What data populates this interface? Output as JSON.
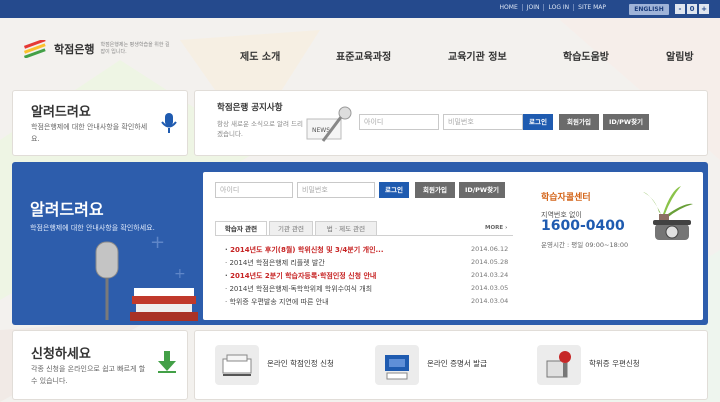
{
  "topbar": {
    "links": [
      "HOME",
      "JOIN",
      "LOG IN",
      "SITE MAP"
    ],
    "english": "ENGLISH",
    "font_controls": [
      "-",
      "0",
      "+"
    ]
  },
  "header": {
    "logo_title": "학점은행",
    "logo_sub": "학점은행제는 평생학습을 위한 길잡이 입니다.",
    "nav": [
      "제도 소개",
      "표준교육과정",
      "교육기관 정보",
      "학습도움방",
      "알림방"
    ]
  },
  "top_left_card": {
    "title": "알려드려요",
    "desc": "학점은행제에 대한 안내사항을 확인하세요."
  },
  "notice_card": {
    "title": "학점은행 공지사항",
    "desc": "항상 새로운 소식으로 알려 드리겠습니다.",
    "id_placeholder": "아이디",
    "pw_placeholder": "비밀번호",
    "login": "로그인",
    "join": "회원가입",
    "find": "ID/PW찾기"
  },
  "main": {
    "title": "알려드려요",
    "desc": "학점은행제에 대한 안내사항을 확인하세요.",
    "id_placeholder": "아이디",
    "pw_placeholder": "비밀번호",
    "login": "로그인",
    "join": "회원가입",
    "find": "ID/PW찾기",
    "tabs": [
      "학습자 관련",
      "기관 관련",
      "법 · 제도 관련"
    ],
    "more": "MORE",
    "news": [
      {
        "text": "2014년도 후기(8월) 학위신청 및 3/4분기 개인...",
        "date": "2014.06.12",
        "red": true
      },
      {
        "text": "2014년 학점은행제 리플렛 발간",
        "date": "2014.05.28",
        "red": false
      },
      {
        "text": "2014년도 2분기 학습자등록·학점인정 신청 안내",
        "date": "2014.03.24",
        "red": true
      },
      {
        "text": "2014년 학점은행제·독학학위제 학위수여식 개최",
        "date": "2014.03.05",
        "red": false
      },
      {
        "text": "학위증 우편발송 지연에 따른 안내",
        "date": "2014.03.04",
        "red": false
      }
    ],
    "call_center": {
      "title": "학습자콜센터",
      "sub": "지역번호 없이",
      "number": "1600-0400",
      "hours": "운영시간 : 평일 09:00~18:00"
    }
  },
  "apply": {
    "title": "신청하세요",
    "desc": "각종 신청을 온라인으로 쉽고 빠르게 할 수 있습니다.",
    "services": [
      "온라인 학점인정 신청",
      "온라인 증명서 발급",
      "학위증 우편신청"
    ]
  },
  "colors": {
    "topbar": "#254a8d",
    "blue_panel": "#2d5dac",
    "accent_red": "#c62222",
    "login_blue": "#1f5bb0"
  }
}
